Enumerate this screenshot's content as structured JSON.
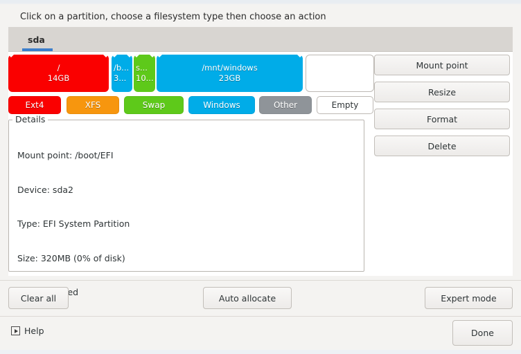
{
  "window": {
    "instruction": "Click on a partition, choose a filesystem type then choose an action"
  },
  "tabs": [
    {
      "label": "sda",
      "selected": true
    }
  ],
  "partition_bar": {
    "disk": "sda",
    "partitions": [
      {
        "name": "root",
        "label_top": "/",
        "label_bottom": "14GB",
        "color": "#fa0000",
        "type": "Ext4",
        "selected": true,
        "truncated": false
      },
      {
        "name": "boot-efi",
        "label_top": "/b...",
        "label_bottom": "3...",
        "color": "#00ace8",
        "type": "Windows",
        "selected": true,
        "truncated": true
      },
      {
        "name": "swap",
        "label_top": "s...",
        "label_bottom": "10...",
        "color": "#5ec91a",
        "type": "Swap",
        "selected": true,
        "truncated": true
      },
      {
        "name": "windows",
        "label_top": "/mnt/windows",
        "label_bottom": "23GB",
        "color": "#00ace8",
        "type": "Windows",
        "selected": true,
        "truncated": false
      },
      {
        "name": "empty",
        "label_top": "",
        "label_bottom": "",
        "color": "#ffffff",
        "type": "Empty",
        "selected": false,
        "truncated": false
      }
    ]
  },
  "filesystem_legend": [
    {
      "label": "Ext4",
      "color": "#fa0000",
      "light": false
    },
    {
      "label": "XFS",
      "color": "#f7960e",
      "light": false
    },
    {
      "label": "Swap",
      "color": "#5ec91a",
      "light": false
    },
    {
      "label": "Windows",
      "color": "#00ace8",
      "light": false
    },
    {
      "label": "Other",
      "color": "#8f9499",
      "light": false
    },
    {
      "label": "Empty",
      "color": "#ffffff",
      "light": true
    }
  ],
  "details": {
    "legend": "Details",
    "lines": [
      "Mount point: /boot/EFI",
      "Device: sda2",
      "Type: EFI System Partition",
      "Size: 320MB (0% of disk)",
      "Not formatted"
    ]
  },
  "actions": [
    {
      "label": "Mount point"
    },
    {
      "label": "Resize"
    },
    {
      "label": "Format"
    },
    {
      "label": "Delete"
    }
  ],
  "bottom_bar": {
    "clear_all": "Clear all",
    "auto_allocate": "Auto allocate",
    "expert_mode": "Expert mode"
  },
  "footer": {
    "help": "Help",
    "help_icon": "play-in-box-icon",
    "done": "Done"
  },
  "colors": {
    "accent": "#3b7ecb",
    "tabbar": "#d8d5d1",
    "panel": "#ffffff",
    "chrome": "#f4f3f1"
  }
}
